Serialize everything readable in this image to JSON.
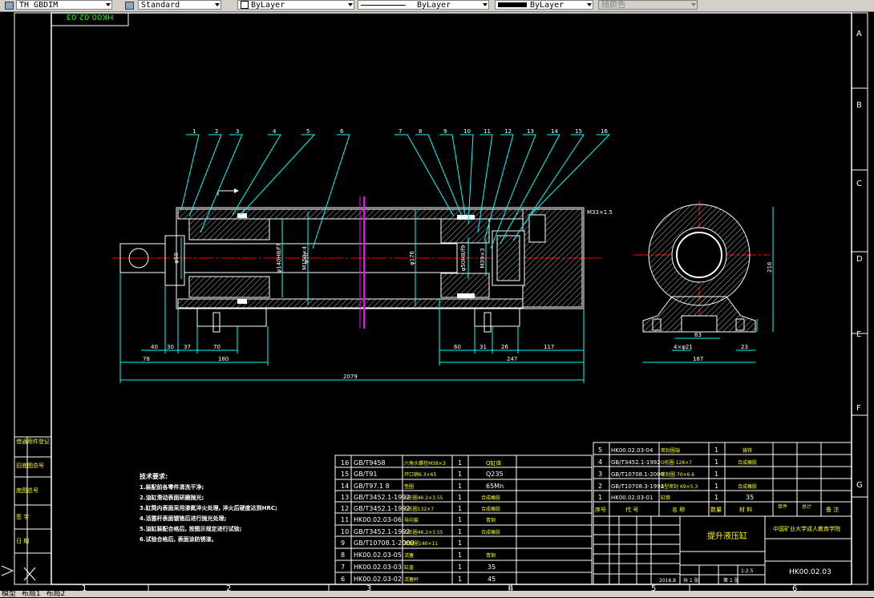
{
  "toolbar": {
    "dimstyle": "TH_GBDIM",
    "textstyle": "Standard",
    "layer_color": "ByLayer",
    "linetype": "ByLayer",
    "lineweight": "ByLayer",
    "plotstyle": "随颜色"
  },
  "drawing_number_rotated": "HK00.02.03",
  "frame": {
    "right_zones": [
      "A",
      "B",
      "C",
      "D",
      "E",
      "F",
      "G"
    ],
    "bottom_zones": [
      "1",
      "2",
      "3",
      "4",
      "5",
      "6"
    ]
  },
  "balloons": [
    "1",
    "2",
    "3",
    "4",
    "5",
    "6",
    "7",
    "8",
    "9",
    "10",
    "11",
    "12",
    "13",
    "14",
    "15",
    "16"
  ],
  "dimensions": {
    "d1": "40",
    "d2": "30",
    "d3": "37",
    "d4": "70",
    "d5": "78",
    "d6": "180",
    "d7": "2079",
    "d8": "60",
    "d9": "31",
    "d10": "26",
    "d11": "117",
    "d12": "247",
    "d13": "63",
    "d14": "4×φ21",
    "d15": "23",
    "d16": "187",
    "d17": "216",
    "d18": "M33×1.5",
    "v1": "φ50",
    "v2": "φ140H8/f7",
    "v3": "M150×4",
    "v4": "φ70",
    "v5": "φ176",
    "v6": "φ50H8/f9",
    "v7": "M39×3"
  },
  "tech_notes": {
    "title": "技术要求:",
    "lines": [
      "1.装配前各零件清洗干净;",
      "2.油缸滑动表面研磨抛光;",
      "3.缸筒内表面采用渗氮淬火处理, 淬火后硬度达到HRC;",
      "4.活塞杆表面镀铬后进行抛光处理;",
      "5.油缸装配合格后, 按图示规定进行试验;",
      "6.试验合格后, 表面涂防锈漆。"
    ]
  },
  "left_strip": [
    "借通用件登记",
    "旧底图总号",
    "底图总号",
    "签 字",
    "日 期"
  ],
  "bom_lower": [
    {
      "no": "16",
      "code": "GB/T9458",
      "name": "六角头螺栓M38×3",
      "qty": "1",
      "mat": "Q缸体"
    },
    {
      "no": "15",
      "code": "GB/T91",
      "name": "开口销6.3×65",
      "qty": "1",
      "mat": "Q235"
    },
    {
      "no": "14",
      "code": "GB/T97.1 8",
      "name": "垫圈",
      "qty": "1",
      "mat": "65Mn"
    },
    {
      "no": "13",
      "code": "GB/T3452.1-1992",
      "name": "O形圈46.2×3.55",
      "qty": "1",
      "mat": "合成橡胶"
    },
    {
      "no": "12",
      "code": "GB/T3452.1-1992",
      "name": "O形圈132×7",
      "qty": "1",
      "mat": "合成橡胶"
    },
    {
      "no": "11",
      "code": "HK00.02.03-06",
      "name": "导向套",
      "qty": "1",
      "mat": "青铜"
    },
    {
      "no": "10",
      "code": "GB/T3452.1-1992",
      "name": "O形圈46.2×3.55",
      "qty": "1",
      "mat": "合成橡胶"
    },
    {
      "no": "9",
      "code": "GB/T10708.1-2000",
      "name": "密封圈140×11",
      "qty": "1",
      "mat": ""
    },
    {
      "no": "8",
      "code": "HK00.02.03-05",
      "name": "活塞",
      "qty": "1",
      "mat": "青铜"
    },
    {
      "no": "7",
      "code": "HK00.02.03-03",
      "name": "缸盖",
      "qty": "1",
      "mat": "35"
    },
    {
      "no": "6",
      "code": "HK00.02.03-02",
      "name": "活塞杆",
      "qty": "1",
      "mat": "45"
    }
  ],
  "bom_upper": [
    {
      "no": "5",
      "code": "HK00.02.03-04",
      "name": "密封圈端",
      "qty": "1",
      "mat": "铸铁"
    },
    {
      "no": "4",
      "code": "GB/T3452.1-1992",
      "name": "O形圈 128×7",
      "qty": "1",
      "mat": "合成橡胶"
    },
    {
      "no": "3",
      "code": "GB/T10708.1-2000",
      "name": "密封圈 70×6.6",
      "qty": "1",
      "mat": ""
    },
    {
      "no": "2",
      "code": "GB/T10708.3-1992",
      "name": "A型密封 69×5.3",
      "qty": "1",
      "mat": "合成橡胶"
    },
    {
      "no": "1",
      "code": "HK00.02.03-01",
      "name": "缸筒",
      "qty": "1",
      "mat": "35"
    }
  ],
  "bom_header": {
    "no": "序号",
    "code": "代  号",
    "name": "名  称",
    "qty": "数量",
    "mat": "材  料",
    "w1": "单件",
    "w2": "总计",
    "remark": "备 注"
  },
  "title_block": {
    "part_name": "提升液压缸",
    "school": "中国矿业大学成人教育学院",
    "drawing_no": "HK00.02.03",
    "scale": "1:2.5",
    "date": "2016.8",
    "sheet": "共 1 张",
    "sheet_of": "第 1 张"
  },
  "layout_tabs": [
    "模型",
    "布局1",
    "布局2"
  ]
}
